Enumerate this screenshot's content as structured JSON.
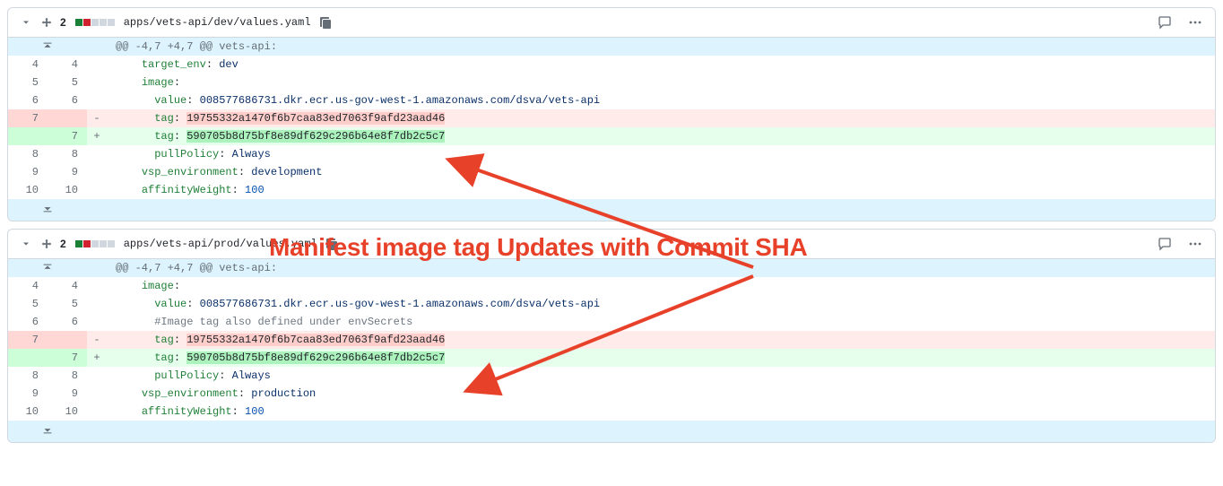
{
  "annotation": {
    "text": "Manifest image tag Updates with Commit SHA"
  },
  "blocks": [
    {
      "header": {
        "change_count": "2",
        "diffstat": {
          "add": 1,
          "del": 1,
          "neutral": 3
        },
        "path": "apps/vets-api/dev/values.yaml"
      },
      "hunk": {
        "text": "@@ -4,7 +4,7 @@ vets-api:"
      },
      "rows": [
        {
          "type": "ctx",
          "old": "4",
          "new": "4",
          "indent": "    ",
          "key": "target_env",
          "val": "dev",
          "valClass": "y-str"
        },
        {
          "type": "ctx",
          "old": "5",
          "new": "5",
          "indent": "    ",
          "key": "image",
          "val": "",
          "noColon": false
        },
        {
          "type": "ctx",
          "old": "6",
          "new": "6",
          "indent": "      ",
          "key": "value",
          "val": "008577686731.dkr.ecr.us-gov-west-1.amazonaws.com/dsva/vets-api",
          "valClass": "y-str"
        },
        {
          "type": "del",
          "old": "7",
          "new": "",
          "indent": "      ",
          "key": "tag",
          "val": "19755332a1470f6b7caa83ed7063f9afd23aad46"
        },
        {
          "type": "add",
          "old": "",
          "new": "7",
          "indent": "      ",
          "key": "tag",
          "val": "590705b8d75bf8e89df629c296b64e8f7db2c5c7"
        },
        {
          "type": "ctx",
          "old": "8",
          "new": "8",
          "indent": "      ",
          "key": "pullPolicy",
          "val": "Always",
          "valClass": "y-str"
        },
        {
          "type": "ctx",
          "old": "9",
          "new": "9",
          "indent": "    ",
          "key": "vsp_environment",
          "val": "development",
          "valClass": "y-str"
        },
        {
          "type": "ctx",
          "old": "10",
          "new": "10",
          "indent": "    ",
          "key": "affinityWeight",
          "val": "100",
          "valClass": "y-num"
        }
      ]
    },
    {
      "header": {
        "change_count": "2",
        "diffstat": {
          "add": 1,
          "del": 1,
          "neutral": 3
        },
        "path": "apps/vets-api/prod/values.yaml"
      },
      "hunk": {
        "text": "@@ -4,7 +4,7 @@ vets-api:"
      },
      "rows": [
        {
          "type": "ctx",
          "old": "4",
          "new": "4",
          "indent": "    ",
          "key": "image",
          "val": ""
        },
        {
          "type": "ctx",
          "old": "5",
          "new": "5",
          "indent": "      ",
          "key": "value",
          "val": "008577686731.dkr.ecr.us-gov-west-1.amazonaws.com/dsva/vets-api",
          "valClass": "y-str"
        },
        {
          "type": "ctx",
          "old": "6",
          "new": "6",
          "indent": "      ",
          "comment": "#Image tag also defined under envSecrets"
        },
        {
          "type": "del",
          "old": "7",
          "new": "",
          "indent": "      ",
          "key": "tag",
          "val": "19755332a1470f6b7caa83ed7063f9afd23aad46"
        },
        {
          "type": "add",
          "old": "",
          "new": "7",
          "indent": "      ",
          "key": "tag",
          "val": "590705b8d75bf8e89df629c296b64e8f7db2c5c7"
        },
        {
          "type": "ctx",
          "old": "8",
          "new": "8",
          "indent": "      ",
          "key": "pullPolicy",
          "val": "Always",
          "valClass": "y-str"
        },
        {
          "type": "ctx",
          "old": "9",
          "new": "9",
          "indent": "    ",
          "key": "vsp_environment",
          "val": "production",
          "valClass": "y-str"
        },
        {
          "type": "ctx",
          "old": "10",
          "new": "10",
          "indent": "    ",
          "key": "affinityWeight",
          "val": "100",
          "valClass": "y-num"
        }
      ]
    }
  ]
}
